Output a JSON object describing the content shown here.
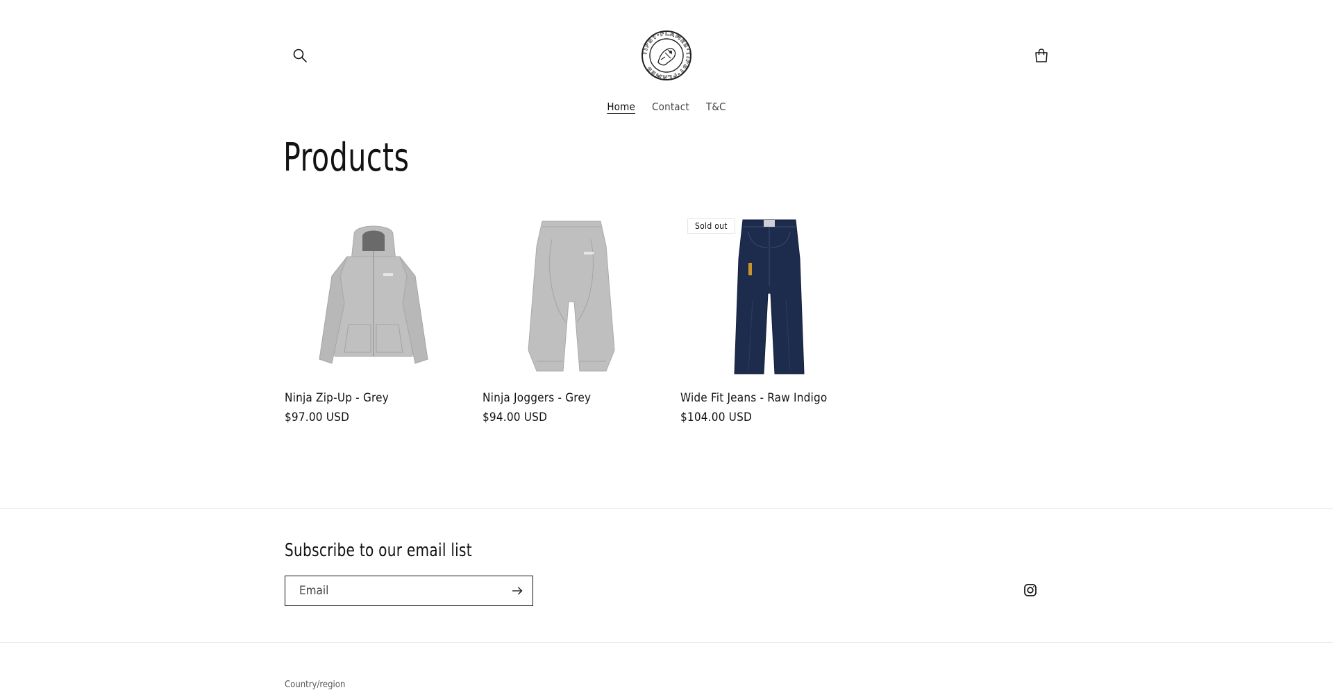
{
  "header": {
    "logo_text": "TIPSY·FLAMES·TIPSY·FLAMES",
    "search_icon": "search-icon",
    "cart_icon": "cart-icon"
  },
  "nav": {
    "items": [
      {
        "label": "Home",
        "active": true
      },
      {
        "label": "Contact",
        "active": false
      },
      {
        "label": "T&C",
        "active": false
      }
    ]
  },
  "main": {
    "title": "Products",
    "products": [
      {
        "title": "Ninja Zip-Up - Grey",
        "price": "$97.00 USD",
        "badge": "",
        "image": "grey-hoodie"
      },
      {
        "title": "Ninja Joggers - Grey",
        "price": "$94.00 USD",
        "badge": "",
        "image": "grey-joggers"
      },
      {
        "title": "Wide Fit Jeans - Raw Indigo",
        "price": "$104.00 USD",
        "badge": "Sold out",
        "image": "indigo-jeans"
      }
    ]
  },
  "footer": {
    "subscribe_title": "Subscribe to our email list",
    "email_placeholder": "Email",
    "email_value": "",
    "submit_icon": "arrow-right-icon",
    "social_icon": "instagram-icon",
    "country_label": "Country/region"
  },
  "colors": {
    "text": "#121212",
    "hoodie": "#b9b9b9",
    "denim": "#1c2a4a"
  }
}
